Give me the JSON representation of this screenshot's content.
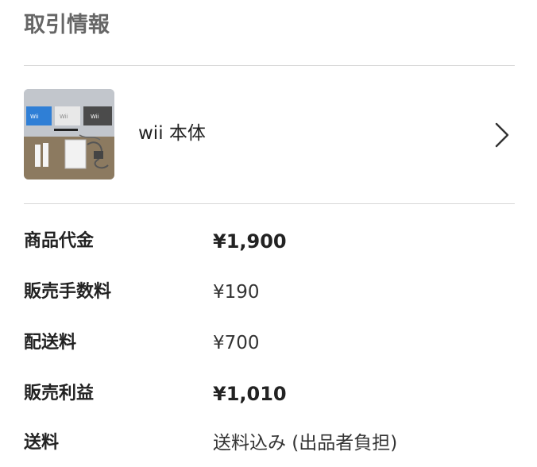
{
  "section": {
    "title": "取引情報"
  },
  "item": {
    "name": "wii 本体",
    "thumbnail_icon": "product-photo-wii-console",
    "chevron_icon": "chevron-right-icon",
    "box_labels": [
      "Wii",
      "Wii",
      "Wii"
    ]
  },
  "summary": {
    "rows": [
      {
        "label": "商品代金",
        "value": "¥1,900"
      },
      {
        "label": "販売手数料",
        "value": "¥190"
      },
      {
        "label": "配送料",
        "value": "¥700"
      },
      {
        "label": "販売利益",
        "value": "¥1,010"
      },
      {
        "label": "送料",
        "value": "送料込み (出品者負担)"
      }
    ]
  },
  "colors": {
    "title_gray": "#666666",
    "divider": "#d9d9d9",
    "text": "#222222"
  }
}
